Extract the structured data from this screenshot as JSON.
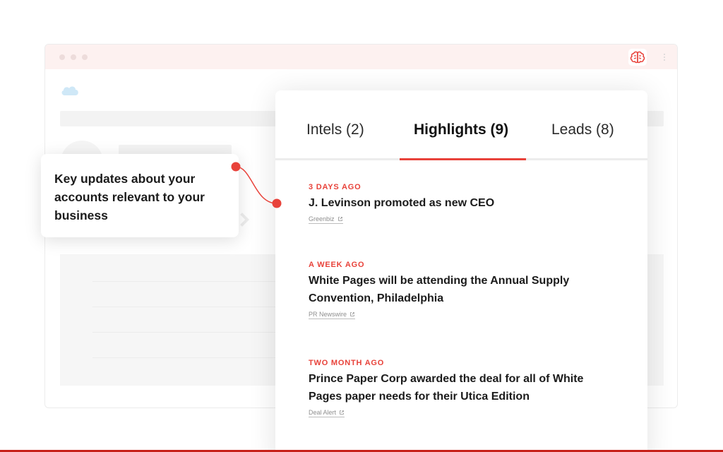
{
  "colors": {
    "accent": "#e8423a",
    "bottom_bar": "#c7211a"
  },
  "icons": {
    "extension": "brain-icon",
    "menu": "kebab-menu-icon",
    "app_logo": "cloud-logo-icon",
    "source_link": "external-link-icon"
  },
  "tabs": [
    {
      "label": "Intels (2)",
      "active": false
    },
    {
      "label": "Highlights (9)",
      "active": true
    },
    {
      "label": "Leads (8)",
      "active": false
    }
  ],
  "highlights": [
    {
      "time": "3 DAYS AGO",
      "title": "J. Levinson promoted as new CEO",
      "source": "Greenbiz"
    },
    {
      "time": "A WEEK AGO",
      "title": "White Pages will be attending the Annual Supply Convention, Philadelphia",
      "source": "PR Newswire"
    },
    {
      "time": "TWO MONTH AGO",
      "title": "Prince Paper Corp awarded the deal for all of White Pages paper needs for their Utica Edition",
      "source": "Deal Alert"
    }
  ],
  "callout": {
    "text": "Key updates about your accounts relevant to your business"
  }
}
